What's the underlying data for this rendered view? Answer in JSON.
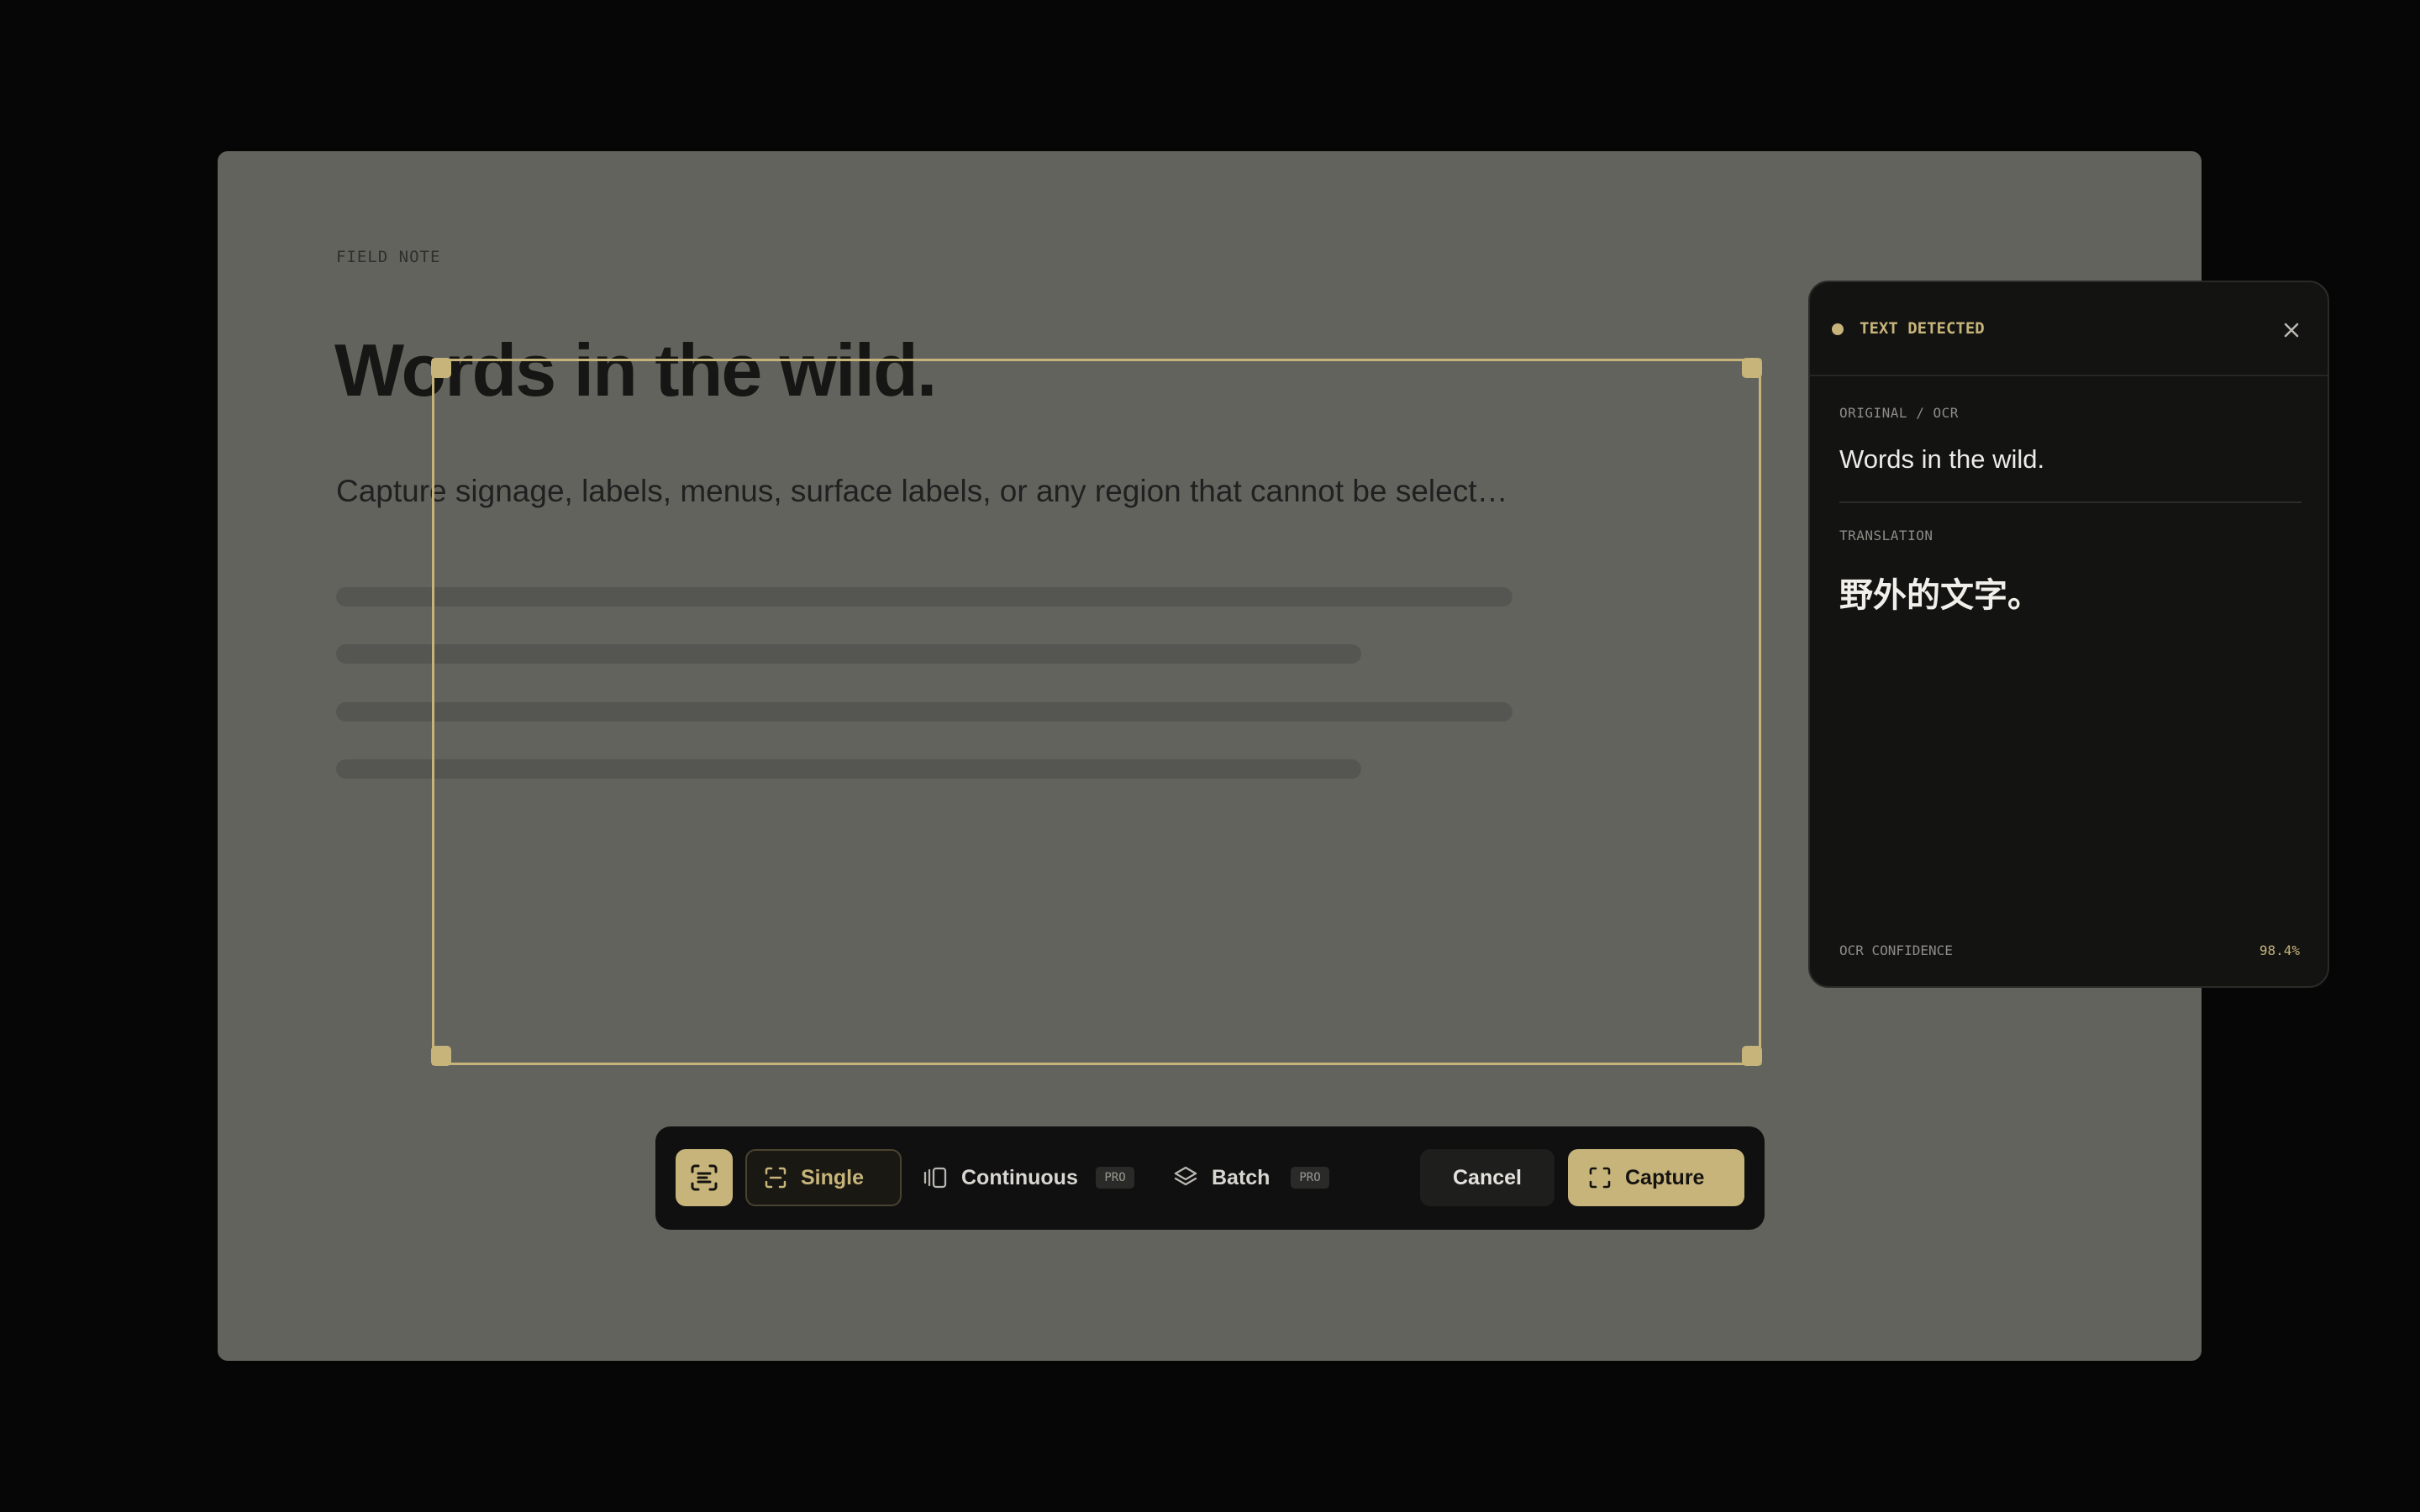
{
  "page": {
    "eyebrow": "FIELD NOTE",
    "headline": "Words in the wild.",
    "lede": "Capture signage, labels, menus, surface labels, or any region that cannot be select…"
  },
  "toolbar": {
    "ocr_icon": "text-scan-icon",
    "modes": [
      {
        "label": "Single",
        "icon": "scan-frame-icon",
        "selected": true
      },
      {
        "label": "Continuous",
        "icon": "continuous-frames-icon",
        "badge": "PRO"
      },
      {
        "label": "Batch",
        "icon": "layers-icon",
        "badge": "PRO"
      }
    ],
    "cancel_label": "Cancel",
    "capture_label": "Capture",
    "capture_icon": "scan-frame-icon"
  },
  "panel": {
    "status": "TEXT DETECTED",
    "original_label": "ORIGINAL / OCR",
    "original_text": "Words in the wild.",
    "translation_label": "TRANSLATION",
    "translation_text": "野外的文字。",
    "confidence_label": "OCR CONFIDENCE",
    "confidence_value": "98.4%"
  },
  "colors": {
    "accent": "#c7b47b",
    "backdrop": "#060606",
    "page_dimmed": "#63635e",
    "toolbar": "#101010",
    "panel": "#131312"
  }
}
